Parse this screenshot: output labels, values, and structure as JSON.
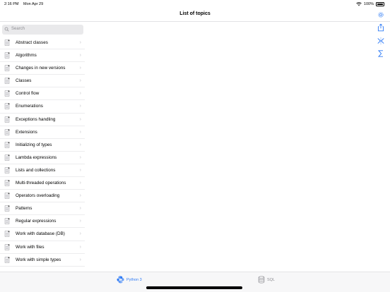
{
  "status_bar": {
    "time": "2:16 PM",
    "date": "Mon Apr 29",
    "battery": "100%"
  },
  "nav": {
    "title": "List of topics"
  },
  "search": {
    "placeholder": "Search"
  },
  "topics": [
    {
      "label": "Abstract classes",
      "icon": "document-icon"
    },
    {
      "label": "Algorithms",
      "icon": "document-icon"
    },
    {
      "label": "Changes in new versions",
      "icon": "document-icon"
    },
    {
      "label": "Classes",
      "icon": "document-icon"
    },
    {
      "label": "Control flow",
      "icon": "document-icon"
    },
    {
      "label": "Enumerations",
      "icon": "document-icon"
    },
    {
      "label": "Exceptions handling",
      "icon": "document-icon"
    },
    {
      "label": "Extensions",
      "icon": "document-icon"
    },
    {
      "label": "Initializing of types",
      "icon": "document-icon"
    },
    {
      "label": "Lambda expressions",
      "icon": "document-icon"
    },
    {
      "label": "Lists and collections",
      "icon": "document-icon"
    },
    {
      "label": "Multi-threaded operations",
      "icon": "document-icon"
    },
    {
      "label": "Operators overloading",
      "icon": "document-icon"
    },
    {
      "label": "Patterns",
      "icon": "document-icon"
    },
    {
      "label": "Regular expressions",
      "icon": "document-icon"
    },
    {
      "label": "Work with database (DB)",
      "icon": "document-icon"
    },
    {
      "label": "Work with files",
      "icon": "document-icon"
    },
    {
      "label": "Work with simple types",
      "icon": "document-icon"
    }
  ],
  "toolbar": {
    "icons": [
      "share-icon",
      "compare-icon",
      "sigma-icon"
    ]
  },
  "tabs": [
    {
      "label": "Python 3",
      "icon": "python-icon",
      "selected": true
    },
    {
      "label": "SQL",
      "icon": "database-icon",
      "selected": false
    }
  ],
  "colors": {
    "accent": "#2f7bf5",
    "inactive": "#8e8e93",
    "separator": "#e3e3e6"
  }
}
